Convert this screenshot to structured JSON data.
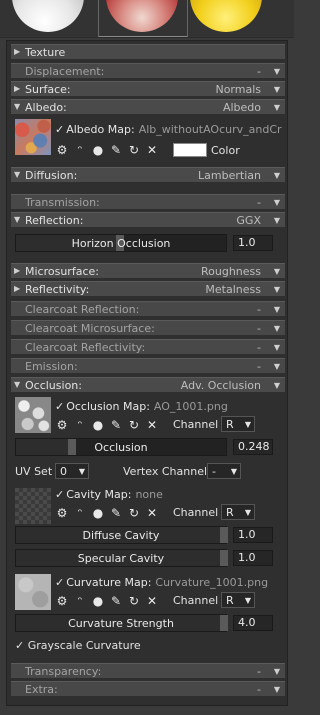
{
  "sections": {
    "texture": "Texture",
    "displacement": "Displacement:",
    "surface": "Surface:",
    "surface_val": "Normals",
    "albedo": "Albedo:",
    "albedo_val": "Albedo",
    "diffusion": "Diffusion:",
    "diffusion_val": "Lambertian",
    "transmission": "Transmission:",
    "reflection": "Reflection:",
    "reflection_val": "GGX",
    "microsurface": "Microsurface:",
    "microsurface_val": "Roughness",
    "reflectivity": "Reflectivity:",
    "reflectivity_val": "Metalness",
    "clearcoat_reflection": "Clearcoat Reflection:",
    "clearcoat_microsurface": "Clearcoat Microsurface:",
    "clearcoat_reflectivity": "Clearcoat Reflectivity:",
    "emission": "Emission:",
    "occlusion": "Occlusion:",
    "occlusion_val": "Adv. Occlusion",
    "transparency": "Transparency:",
    "extra": "Extra:",
    "dash": "-"
  },
  "albedo_map": {
    "label": "Albedo Map:",
    "file": "Alb_withoutAOcurv_andCr",
    "color_label": "Color",
    "color_hex": "#ffffff"
  },
  "reflection": {
    "horizon_occlusion_label": "Horizon Occlusion",
    "horizon_occlusion_value": "1.0"
  },
  "occlusion": {
    "map_label": "Occlusion Map:",
    "map_file": "AO_1001.png",
    "channel_label": "Channel",
    "channel_value": "R",
    "slider_label": "Occlusion",
    "slider_value": "0.248",
    "uvset_label": "UV Set",
    "uvset_value": "0",
    "vertex_channel_label": "Vertex Channel",
    "vertex_channel_value": "-",
    "cavity_label": "Cavity Map:",
    "cavity_file": "none",
    "cavity_channel_label": "Channel",
    "cavity_channel_value": "R",
    "diffuse_cavity_label": "Diffuse Cavity",
    "diffuse_cavity_value": "1.0",
    "specular_cavity_label": "Specular Cavity",
    "specular_cavity_value": "1.0",
    "curvature_label": "Curvature Map:",
    "curvature_file": "Curvature_1001.png",
    "curvature_channel_label": "Channel",
    "curvature_channel_value": "R",
    "curvature_strength_label": "Curvature Strength",
    "curvature_strength_value": "4.0",
    "grayscale_label": "Grayscale Curvature"
  },
  "icons": [
    "gear-icon",
    "wand-icon",
    "sphere-icon",
    "brush-icon",
    "refresh-icon",
    "close-icon"
  ]
}
